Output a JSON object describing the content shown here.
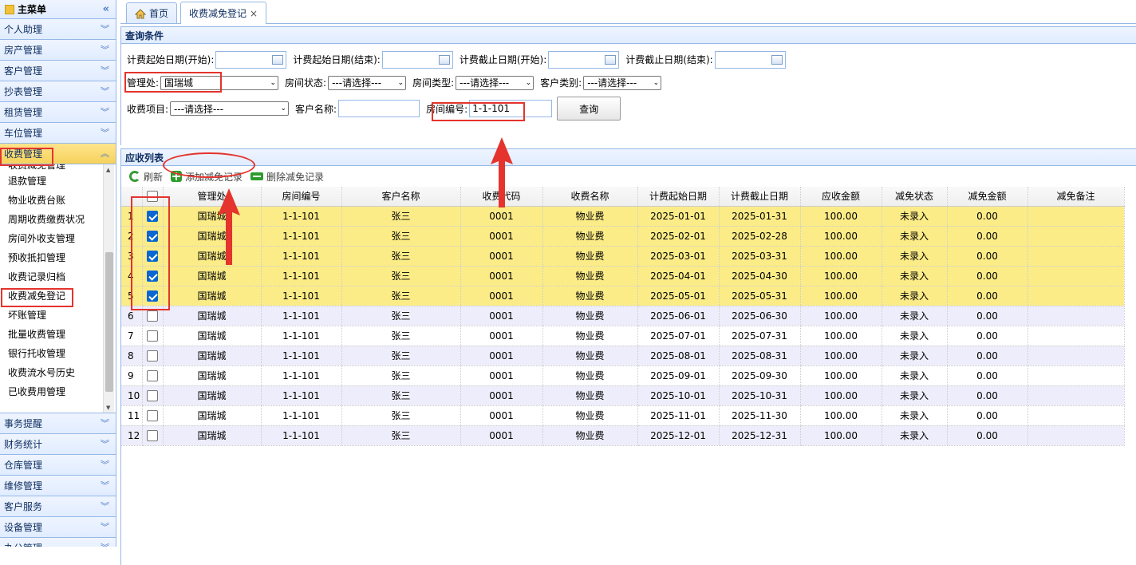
{
  "sidebar": {
    "title": "主菜单",
    "top_items": [
      "个人助理",
      "房产管理",
      "客户管理",
      "抄表管理",
      "租赁管理",
      "车位管理"
    ],
    "active_section": "收费管理",
    "sub_items": [
      "退款管理",
      "物业收费台账",
      "周期收费缴费状况",
      "房间外收支管理",
      "预收抵扣管理",
      "收费记录归档",
      "收费减免登记",
      "坏账管理",
      "批量收费管理",
      "银行托收管理",
      "收费流水号历史",
      "已收费用管理"
    ],
    "bottom_items": [
      "事务提醒",
      "财务统计",
      "仓库管理",
      "维修管理",
      "客户服务",
      "设备管理",
      "办公管理"
    ]
  },
  "tabs": [
    {
      "label": "首页",
      "icon": "home-icon"
    },
    {
      "label": "收费减免登记",
      "close": "×"
    }
  ],
  "query": {
    "header": "查询条件",
    "row1": [
      {
        "label": "计费起始日期(开始):",
        "value": ""
      },
      {
        "label": "计费起始日期(结束):",
        "value": ""
      },
      {
        "label": "计费截止日期(开始):",
        "value": ""
      },
      {
        "label": "计费截止日期(结束):",
        "value": ""
      }
    ],
    "row2": [
      {
        "label": "管理处:",
        "value": "国瑞城"
      },
      {
        "label": "房间状态:",
        "value": "---请选择---"
      },
      {
        "label": "房间类型:",
        "value": "---请选择---"
      },
      {
        "label": "客户类别:",
        "value": "---请选择---"
      }
    ],
    "fee_item_label": "收费项目:",
    "fee_item_value": "---请选择---",
    "customer_label": "客户名称:",
    "customer_value": "",
    "room_label": "房间编号:",
    "room_value": "1-1-101",
    "search_button": "查询"
  },
  "list": {
    "header": "应收列表",
    "toolbar": {
      "refresh": "刷新",
      "add": "添加减免记录",
      "delete": "删除减免记录"
    },
    "columns": [
      "管理处",
      "房间编号",
      "客户名称",
      "收费代码",
      "收费名称",
      "计费起始日期",
      "计费截止日期",
      "应收金额",
      "减免状态",
      "减免金额",
      "减免备注"
    ],
    "rows": [
      {
        "n": "1",
        "checked": true,
        "cells": [
          "国瑞城",
          "1-1-101",
          "张三",
          "0001",
          "物业费",
          "2025-01-01",
          "2025-01-31",
          "100.00",
          "未录入",
          "0.00",
          ""
        ]
      },
      {
        "n": "2",
        "checked": true,
        "cells": [
          "国瑞城",
          "1-1-101",
          "张三",
          "0001",
          "物业费",
          "2025-02-01",
          "2025-02-28",
          "100.00",
          "未录入",
          "0.00",
          ""
        ]
      },
      {
        "n": "3",
        "checked": true,
        "cells": [
          "国瑞城",
          "1-1-101",
          "张三",
          "0001",
          "物业费",
          "2025-03-01",
          "2025-03-31",
          "100.00",
          "未录入",
          "0.00",
          ""
        ]
      },
      {
        "n": "4",
        "checked": true,
        "cells": [
          "国瑞城",
          "1-1-101",
          "张三",
          "0001",
          "物业费",
          "2025-04-01",
          "2025-04-30",
          "100.00",
          "未录入",
          "0.00",
          ""
        ]
      },
      {
        "n": "5",
        "checked": true,
        "cells": [
          "国瑞城",
          "1-1-101",
          "张三",
          "0001",
          "物业费",
          "2025-05-01",
          "2025-05-31",
          "100.00",
          "未录入",
          "0.00",
          ""
        ]
      },
      {
        "n": "6",
        "checked": false,
        "cells": [
          "国瑞城",
          "1-1-101",
          "张三",
          "0001",
          "物业费",
          "2025-06-01",
          "2025-06-30",
          "100.00",
          "未录入",
          "0.00",
          ""
        ]
      },
      {
        "n": "7",
        "checked": false,
        "cells": [
          "国瑞城",
          "1-1-101",
          "张三",
          "0001",
          "物业费",
          "2025-07-01",
          "2025-07-31",
          "100.00",
          "未录入",
          "0.00",
          ""
        ]
      },
      {
        "n": "8",
        "checked": false,
        "cells": [
          "国瑞城",
          "1-1-101",
          "张三",
          "0001",
          "物业费",
          "2025-08-01",
          "2025-08-31",
          "100.00",
          "未录入",
          "0.00",
          ""
        ]
      },
      {
        "n": "9",
        "checked": false,
        "cells": [
          "国瑞城",
          "1-1-101",
          "张三",
          "0001",
          "物业费",
          "2025-09-01",
          "2025-09-30",
          "100.00",
          "未录入",
          "0.00",
          ""
        ]
      },
      {
        "n": "10",
        "checked": false,
        "cells": [
          "国瑞城",
          "1-1-101",
          "张三",
          "0001",
          "物业费",
          "2025-10-01",
          "2025-10-31",
          "100.00",
          "未录入",
          "0.00",
          ""
        ]
      },
      {
        "n": "11",
        "checked": false,
        "cells": [
          "国瑞城",
          "1-1-101",
          "张三",
          "0001",
          "物业费",
          "2025-11-01",
          "2025-11-30",
          "100.00",
          "未录入",
          "0.00",
          ""
        ]
      },
      {
        "n": "12",
        "checked": false,
        "cells": [
          "国瑞城",
          "1-1-101",
          "张三",
          "0001",
          "物业费",
          "2025-12-01",
          "2025-12-31",
          "100.00",
          "未录入",
          "0.00",
          ""
        ]
      }
    ]
  },
  "colors": {
    "accent_border": "#95b8e7",
    "checked_row": "#fbec88",
    "alt_row": "#eeedfb",
    "annotation_red": "#e4342d"
  }
}
